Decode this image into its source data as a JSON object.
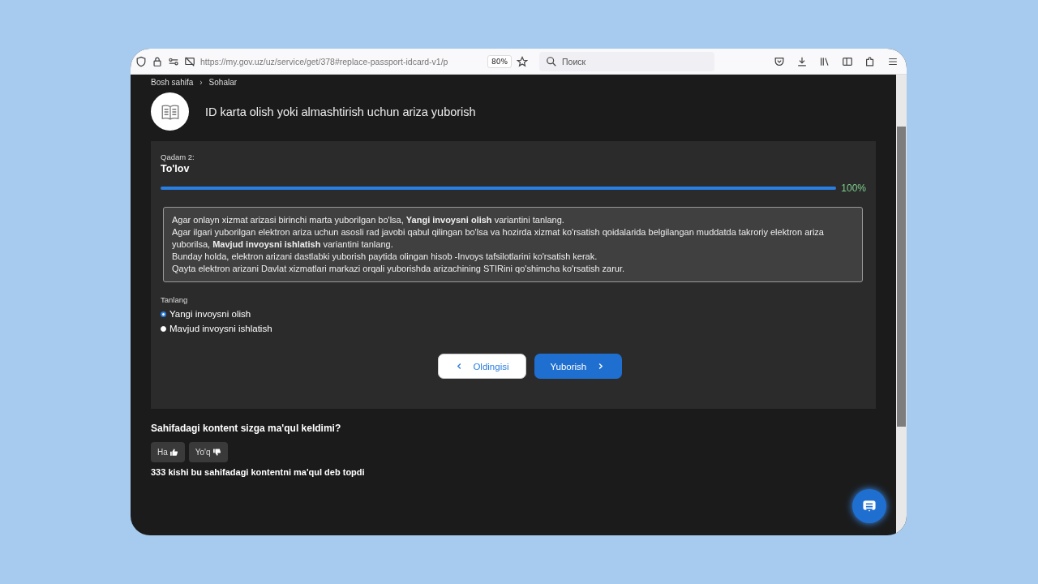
{
  "browser": {
    "url": "https://my.gov.uz/uz/service/get/378#replace-passport-idcard-v1/p",
    "zoom": "80%",
    "search": {
      "placeholder": "Поиск"
    }
  },
  "breadcrumbs": [
    {
      "label": "Bosh sahifa"
    },
    {
      "label": "Sohalar"
    }
  ],
  "separator": "›",
  "page_title": "ID karta olish yoki almashtirish uchun ariza yuborish",
  "step": {
    "label": "Qadam 2:",
    "title": "To'lov",
    "level": 1,
    "percent": "100%"
  },
  "info": [
    "Agar onlayn xizmat arizasi birinchi marta yuborilgan bo'lsa, **Yangi invoysni olish** variantini tanlang.",
    "Agar ilgari yuborilgan elektron ariza uchun asosli rad javobi qabul qilingan bo'lsa va hozirda xizmat ko'rsatish qoidalarida belgilangan muddatda takroriy elektron ariza yuborilsa, **Mavjud invoysni ishlatish** variantini tanlang.",
    "Bunday holda, elektron arizani dastlabki yuborish paytida olingan hisob -Invoys tafsilotlarini ko'rsatish kerak.",
    "Qayta elektron arizani Davlat xizmatlari markazi orqali yuborishda arizachining STIRini qo'shimcha ko'rsatish zarur."
  ],
  "choice": {
    "label": "Tanlang",
    "options": [
      {
        "label": "Yangi invoysni olish",
        "selected": true
      },
      {
        "label": "Mavjud invoysni ishlatish",
        "selected": false
      }
    ]
  },
  "buttons": {
    "back": "Oldingisi",
    "submit": "Yuborish"
  },
  "feedback": {
    "question": "Sahifadagi kontent sizga ma'qul keldimi?",
    "yes": "Ha",
    "no": "Yo'q",
    "summary": "333 kishi bu sahifadagi kontentni ma'qul deb topdi"
  }
}
